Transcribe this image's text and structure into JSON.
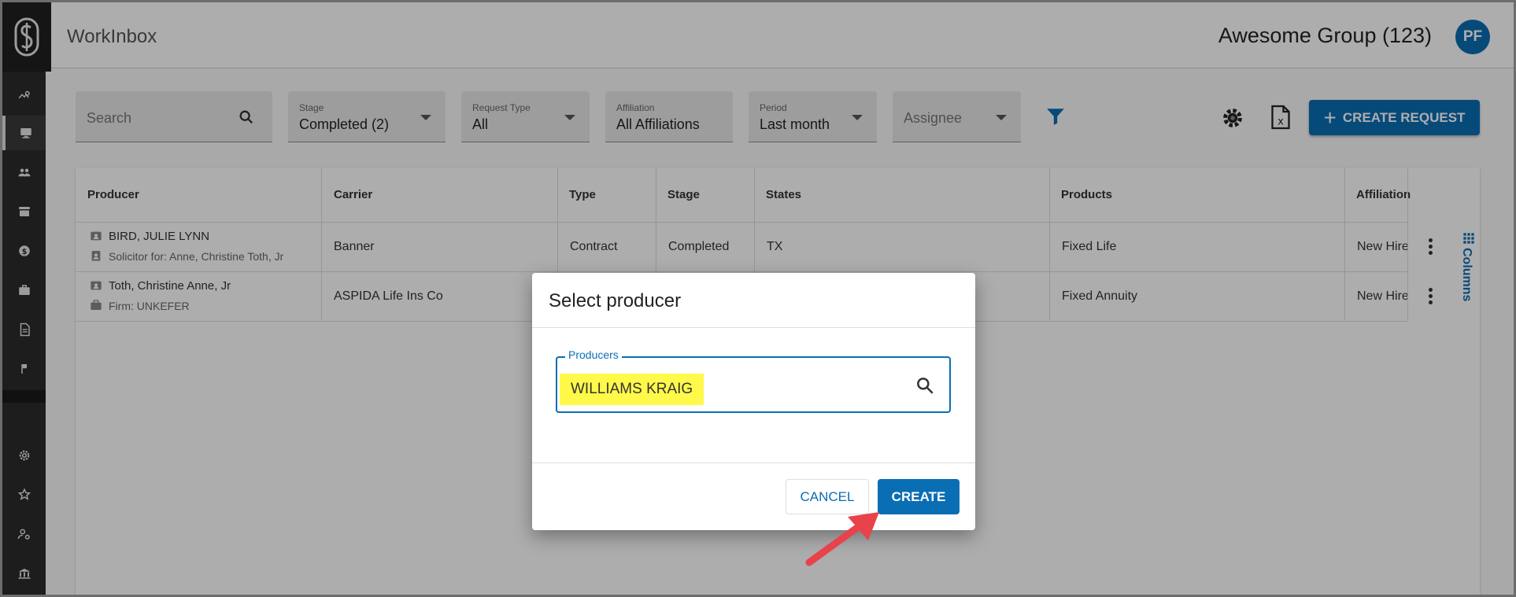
{
  "app": {
    "title": "WorkInbox",
    "group": "Awesome Group (123)",
    "avatar_initials": "PF"
  },
  "sidebar": {
    "icons": [
      "analytics-icon",
      "monitor-icon",
      "people-icon",
      "store-icon",
      "dollar-icon",
      "briefcase-icon",
      "document-icon",
      "flag-icon",
      "settings-icon",
      "star-badge-icon",
      "user-settings-icon",
      "bank-icon"
    ],
    "active_index": 1
  },
  "toolbar": {
    "search_placeholder": "Search",
    "stage": {
      "label": "Stage",
      "value": "Completed (2)"
    },
    "request_type": {
      "label": "Request Type",
      "value": "All"
    },
    "affiliation": {
      "label": "Affiliation",
      "value": "All Affiliations"
    },
    "period": {
      "label": "Period",
      "value": "Last month"
    },
    "assignee_placeholder": "Assignee",
    "create_request_label": "CREATE REQUEST"
  },
  "table": {
    "columns": [
      "Producer",
      "Carrier",
      "Type",
      "Stage",
      "States",
      "Products",
      "Affiliation"
    ],
    "rows": [
      {
        "producer": "BIRD, JULIE LYNN",
        "producer_sub": "Solicitor for: Anne, Christine Toth, Jr",
        "carrier": "Banner",
        "type": "Contract",
        "stage": "Completed",
        "states": "TX",
        "products": "Fixed Life",
        "affiliation": "New Hire"
      },
      {
        "producer": "Toth, Christine Anne, Jr",
        "producer_sub": "Firm: UNKEFER",
        "carrier": "ASPIDA Life Ins Co",
        "type": "",
        "stage": "",
        "states": "",
        "products": "Fixed Annuity",
        "affiliation": "New Hire"
      }
    ],
    "columns_tab_label": "Columns"
  },
  "dialog": {
    "title": "Select producer",
    "field_label": "Producers",
    "field_value": "WILLIAMS KRAIG",
    "cancel_label": "CANCEL",
    "create_label": "CREATE"
  },
  "colors": {
    "accent": "#0a6eb4",
    "highlight": "#fff94a",
    "arrow": "#e8424a"
  }
}
